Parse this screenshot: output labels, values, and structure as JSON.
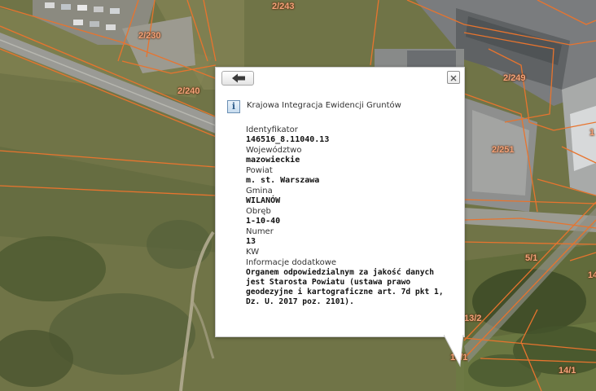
{
  "map": {
    "parcel_labels": [
      "2/243",
      "2/230",
      "2/240",
      "2/249",
      "2/251",
      "5/1",
      "13/2",
      "13/1",
      "14/1",
      "1",
      "14"
    ]
  },
  "popup": {
    "back_icon": "left-arrow-icon",
    "close_icon": "close-x-icon",
    "info_icon": "info-icon",
    "info_icon_glyph": "i",
    "service_title": "Krajowa Integracja Ewidencji Gruntów",
    "fields": [
      {
        "label": "Identyfikator",
        "value": "146516_8.11040.13"
      },
      {
        "label": "Województwo",
        "value": "mazowieckie"
      },
      {
        "label": "Powiat",
        "value": "m. st. Warszawa"
      },
      {
        "label": "Gmina",
        "value": "WILANÓW"
      },
      {
        "label": "Obręb",
        "value": "1-10-40"
      },
      {
        "label": "Numer",
        "value": "13"
      },
      {
        "label": "KW",
        "value": ""
      },
      {
        "label": "Informacje dodatkowe",
        "value": "Organem odpowiedzialnym za jakość danych jest Starosta Powiatu (ustawa prawo geodezyjne i kartograficzne art. 7d pkt 1, Dz. U. 2017 poz. 2101)."
      }
    ]
  },
  "colors": {
    "parcel_line": "#e8742e",
    "parcel_label": "#f4a37a"
  }
}
